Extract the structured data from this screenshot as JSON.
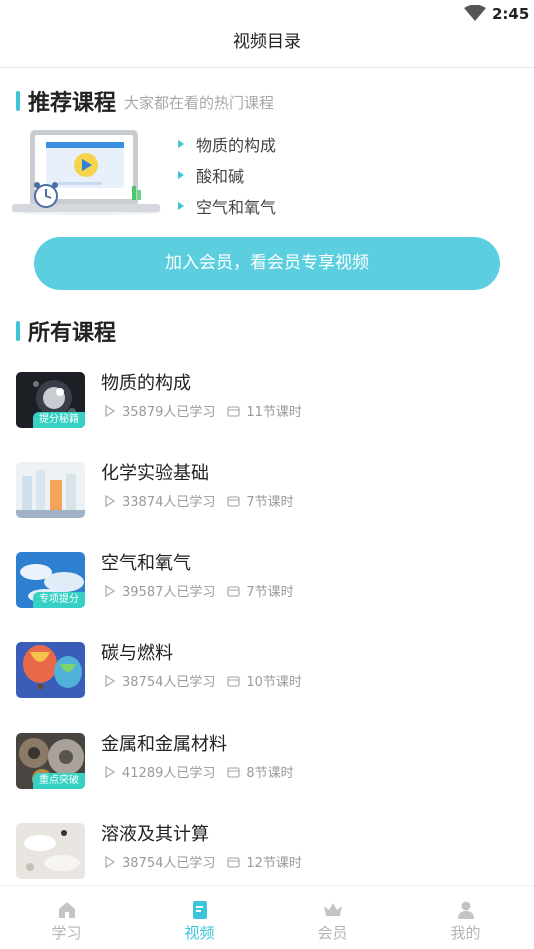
{
  "status_bar": {
    "time": "2:45"
  },
  "header": {
    "title": "视频目录"
  },
  "recommended": {
    "heading": "推荐课程",
    "subheading": "大家都在看的热门课程",
    "items": [
      "物质的构成",
      "酸和碱",
      "空气和氧气"
    ]
  },
  "join_button": {
    "label": "加入会员，看会员专享视频"
  },
  "all_courses": {
    "heading": "所有课程",
    "items": [
      {
        "name": "物质的构成",
        "learners": "35879人已学习",
        "lessons": "11节课时",
        "tag": "提分秘籍",
        "thumb": "dark-atom-image"
      },
      {
        "name": "化学实验基础",
        "learners": "33874人已学习",
        "lessons": "7节课时",
        "tag": "",
        "thumb": "lab-bottles-image"
      },
      {
        "name": "空气和氧气",
        "learners": "39587人已学习",
        "lessons": "7节课时",
        "tag": "专项提分",
        "thumb": "blue-sky-image"
      },
      {
        "name": "碳与燃料",
        "learners": "38754人已学习",
        "lessons": "10节课时",
        "tag": "",
        "thumb": "hot-air-balloon-image"
      },
      {
        "name": "金属和金属材料",
        "learners": "41289人已学习",
        "lessons": "8节课时",
        "tag": "重点突破",
        "thumb": "metal-gears-image"
      },
      {
        "name": "溶液及其计算",
        "learners": "38754人已学习",
        "lessons": "12节课时",
        "tag": "",
        "thumb": "white-powder-image"
      }
    ]
  },
  "tab_bar": {
    "tabs": [
      {
        "label": "学习",
        "icon": "home-icon",
        "active": false
      },
      {
        "label": "视频",
        "icon": "video-book-icon",
        "active": true
      },
      {
        "label": "会员",
        "icon": "crown-icon",
        "active": false
      },
      {
        "label": "我的",
        "icon": "profile-icon",
        "active": false
      }
    ]
  },
  "colors": {
    "accent": "#3cc4d9",
    "button": "#5bcfdf",
    "tag": "#36d1c4",
    "muted": "#9a9a9a"
  }
}
